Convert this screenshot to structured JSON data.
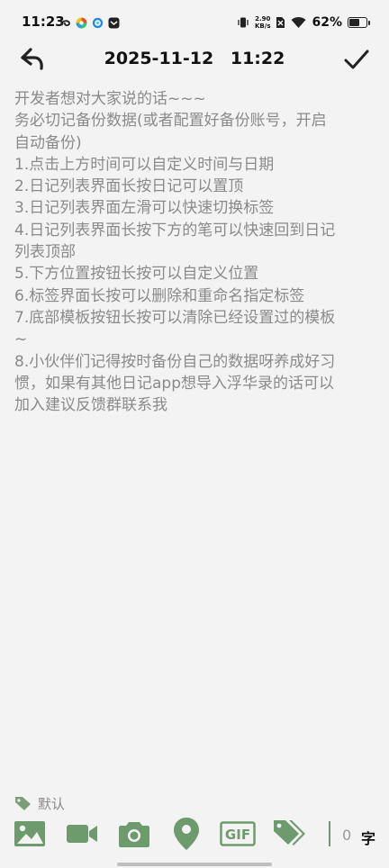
{
  "status_bar": {
    "time": "11:23",
    "app_icons": [
      "swirl-icon",
      "colorful-app-icon",
      "blue-c-icon",
      "message-app-icon"
    ],
    "net_speed_value": "2.90",
    "net_speed_unit": "KB/s",
    "battery_percent": "62%"
  },
  "toolbar": {
    "date": "2025-11-12",
    "time": "11:22"
  },
  "content": {
    "lines": [
      "开发者想对大家说的话~~~",
      "务必切记备份数据(或者配置好备份账号，开启",
      "自动备份)",
      "1.点击上方时间可以自定义时间与日期",
      "2.日记列表界面长按日记可以置顶",
      "3.日记列表界面左滑可以快速切换标签",
      "4.日记列表界面长按下方的笔可以快速回到日记",
      "列表顶部",
      "5.下方位置按钮长按可以自定义位置",
      "6.标签界面长按可以删除和重命名指定标签",
      "7.底部模板按钮长按可以清除已经设置过的模板",
      "~",
      "8.小伙伴们记得按时备份自己的数据呀养成好习",
      "惯，如果有其他日记app想导入浮华录的话可以",
      "加入建议反馈群联系我"
    ]
  },
  "tag": {
    "label": "默认"
  },
  "bottom_tools": {
    "gif_label": "GIF",
    "word_count": "0",
    "word_unit": "字"
  },
  "colors": {
    "accent_green": "#6e9b6e",
    "text_gray": "#8a8a8a",
    "background": "#f3f3f3"
  }
}
